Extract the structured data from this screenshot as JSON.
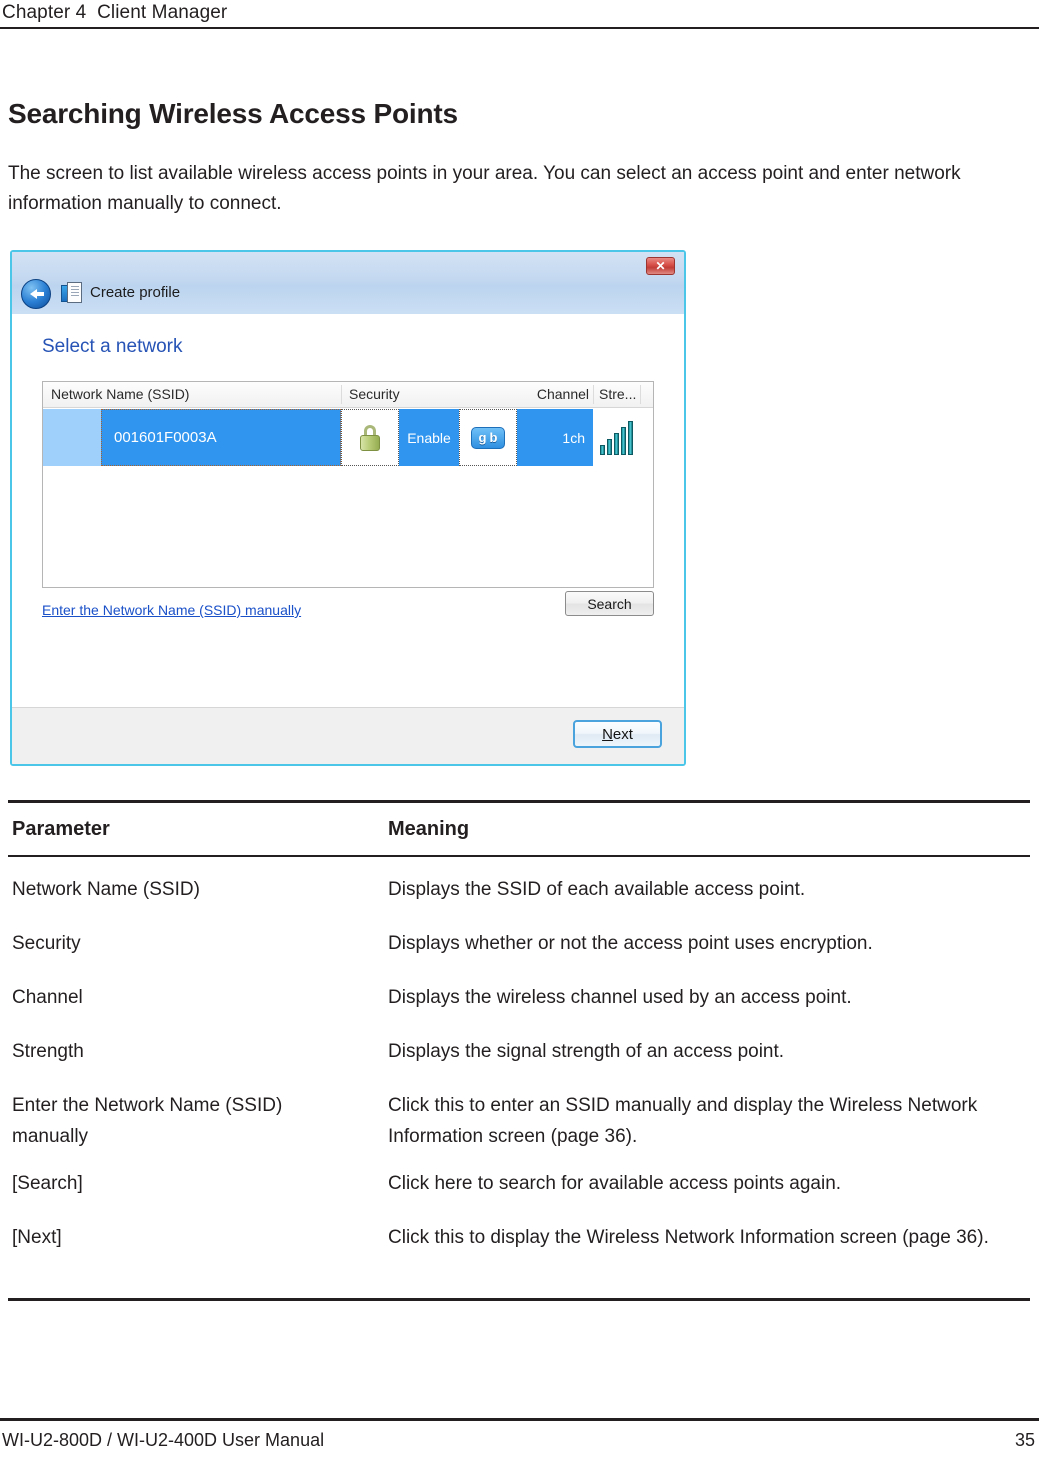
{
  "header": {
    "chapter_text": "Chapter 4  Client Manager"
  },
  "section": {
    "title": "Searching Wireless Access Points",
    "intro": "The screen to list available wireless access points in your area.  You can select an access point and enter network information manually to connect."
  },
  "dialog": {
    "title": "Create profile",
    "close_label": "✕",
    "heading": "Select a network",
    "list": {
      "columns": [
        "Network Name (SSID)",
        "Security",
        "Channel",
        "Stre..."
      ],
      "rows": [
        {
          "ssid": "001601F0003A",
          "security_icon": "padlock-icon",
          "security": "Enable",
          "mode_badge_a": "g",
          "mode_badge_b": "b",
          "channel": "1ch",
          "strength_icon": "signal-bars-icon"
        }
      ]
    },
    "manual_link": "Enter the Network Name (SSID) manually",
    "search_button": "Search",
    "next_button_accel": "N",
    "next_button_rest": "ext"
  },
  "param_table": {
    "headers": [
      "Parameter",
      "Meaning"
    ],
    "rows": [
      {
        "parameter": "Network Name (SSID)",
        "meaning": "Displays the SSID of each available access point."
      },
      {
        "parameter": "Security",
        "meaning": "Displays whether or not the access point uses encryption."
      },
      {
        "parameter": "Channel",
        "meaning": "Displays the wireless channel used by an access point."
      },
      {
        "parameter": "Strength",
        "meaning": "Displays the signal strength of an access point."
      },
      {
        "parameter": "Enter the Network Name (SSID) manually",
        "meaning": "Click this to enter an SSID manually and display the Wireless Network Information screen (page 36)."
      },
      {
        "parameter": "[Search]",
        "meaning": "Click here to search for available access points again."
      },
      {
        "parameter": "[Next]",
        "meaning": "Click this to display the Wireless Network Information screen (page 36)."
      }
    ]
  },
  "footer": {
    "manual_name": "WI-U2-800D / WI-U2-400D User Manual",
    "page_number": "35"
  },
  "colors": {
    "rule": "#231f20",
    "dialog_accent": "#4cc6e8",
    "heading_blue": "#2653b5",
    "row_selected": "#2f95ef",
    "link_blue": "#1a50c8"
  }
}
